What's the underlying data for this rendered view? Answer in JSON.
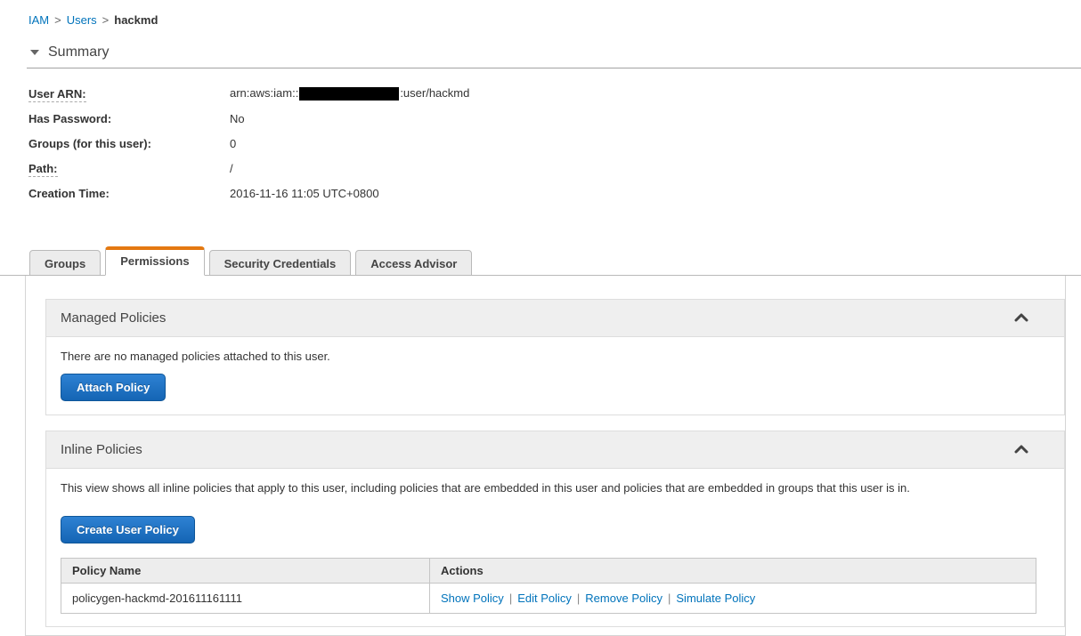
{
  "breadcrumb": {
    "separator": ">",
    "items": [
      {
        "label": "IAM"
      },
      {
        "label": "Users"
      },
      {
        "label": "hackmd"
      }
    ]
  },
  "summary": {
    "title": "Summary",
    "fields": [
      {
        "label": "User ARN:",
        "value_prefix": "arn:aws:iam::",
        "value_suffix": ":user/hackmd",
        "redacted": true
      },
      {
        "label": "Has Password:",
        "value": "No"
      },
      {
        "label": "Groups (for this user):",
        "value": "0"
      },
      {
        "label": "Path:",
        "value": "/"
      },
      {
        "label": "Creation Time:",
        "value": "2016-11-16 11:05 UTC+0800"
      }
    ]
  },
  "tabs": [
    {
      "label": "Groups"
    },
    {
      "label": "Permissions"
    },
    {
      "label": "Security Credentials"
    },
    {
      "label": "Access Advisor"
    }
  ],
  "managed_policies": {
    "title": "Managed Policies",
    "empty_text": "There are no managed policies attached to this user.",
    "attach_button": "Attach Policy",
    "collapse_icon": "chevron-up"
  },
  "inline_policies": {
    "title": "Inline Policies",
    "description": "This view shows all inline policies that apply to this user, including policies that are embedded in this user and policies that are embedded in groups that this user is in.",
    "create_button": "Create User Policy",
    "collapse_icon": "chevron-up",
    "table": {
      "headers": [
        "Policy Name",
        "Actions"
      ],
      "rows": [
        {
          "policy_name": "policygen-hackmd-201611161111",
          "actions": [
            "Show Policy",
            "Edit Policy",
            "Remove Policy",
            "Simulate Policy"
          ]
        }
      ]
    }
  },
  "colors": {
    "link_blue": "#0073bb",
    "tab_accent_orange": "#e47911",
    "primary_button_blue": "#1465b4",
    "section_header_bg": "#efefef"
  }
}
